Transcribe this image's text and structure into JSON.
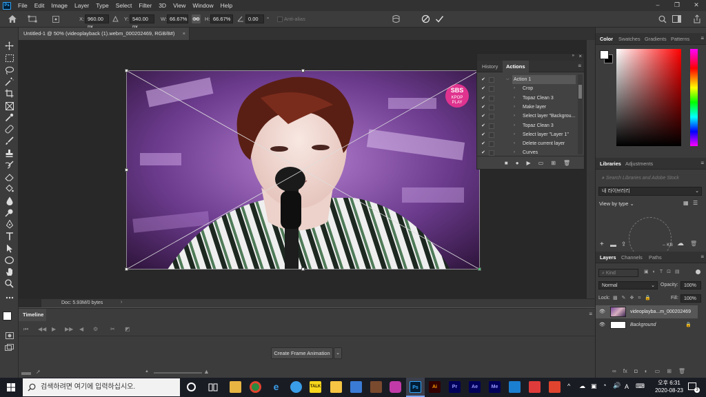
{
  "app": {
    "logo_text": "Ps"
  },
  "menubar": {
    "items": [
      "File",
      "Edit",
      "Image",
      "Layer",
      "Type",
      "Select",
      "Filter",
      "3D",
      "View",
      "Window",
      "Help"
    ]
  },
  "window_controls": [
    "–",
    "❐",
    "✕"
  ],
  "options_bar": {
    "x_label": "X:",
    "x_value": "960.00 px",
    "y_label": "Y:",
    "y_value": "540.00 px",
    "w_label": "W:",
    "w_value": "66.67%",
    "h_label": "H:",
    "h_value": "66.67%",
    "angle_value": "0.00",
    "angle_unit": "°",
    "antialias_label": "Anti-alias"
  },
  "document": {
    "tab_title": "Untitled-1 @ 50% (videoplayback (1).webm_000202469, RGB/8#)",
    "status_text": "Doc: 5.93M/0 bytes",
    "watermark_line1": "SBS",
    "watermark_line2": "KPOP",
    "watermark_line3": "PLAY"
  },
  "actions_panel": {
    "tabs": [
      "History",
      "Actions"
    ],
    "active_tab": "Actions",
    "items": [
      {
        "label": "Action 1",
        "level": 0,
        "checked": true
      },
      {
        "label": "Crop",
        "level": 1,
        "checked": true
      },
      {
        "label": "Topaz Clean 3",
        "level": 1,
        "checked": true
      },
      {
        "label": "Make layer",
        "level": 1,
        "checked": true
      },
      {
        "label": "Select layer \"Backgrou...",
        "level": 1,
        "checked": true
      },
      {
        "label": "Topaz Clean 3",
        "level": 1,
        "checked": true
      },
      {
        "label": "Select layer \"Layer 1\"",
        "level": 1,
        "checked": true
      },
      {
        "label": "Delete current layer",
        "level": 1,
        "checked": true
      },
      {
        "label": "Curves",
        "level": 1,
        "checked": true
      }
    ]
  },
  "timeline": {
    "tab_label": "Timeline",
    "create_button": "Create Frame Animation"
  },
  "color_panel": {
    "tabs": [
      "Color",
      "Swatches",
      "Gradients",
      "Patterns"
    ],
    "active_tab": "Color",
    "hue_color": "#ff0000"
  },
  "libraries_panel": {
    "tabs": [
      "Libraries",
      "Adjustments"
    ],
    "active_tab": "Libraries",
    "search_placeholder": "Search Libraries and Adobe Stock",
    "library_name": "내 라이브러리",
    "view_by": "View by type",
    "size_label": "-- KB"
  },
  "layers_panel": {
    "tabs": [
      "Layers",
      "Channels",
      "Paths"
    ],
    "active_tab": "Layers",
    "filter_label": "Kind",
    "blend_mode": "Normal",
    "opacity_label": "Opacity:",
    "opacity_value": "100%",
    "lock_label": "Lock:",
    "fill_label": "Fill:",
    "fill_value": "100%",
    "layers": [
      {
        "name": "videoplayba...m_000202469",
        "selected": true
      },
      {
        "name": "Background",
        "selected": false
      }
    ]
  },
  "taskbar": {
    "search_placeholder": "검색하려면 여기에 입력하십시오.",
    "apps": [
      "Ai",
      "Pr",
      "Ae",
      "Me"
    ],
    "ime": "A",
    "time": "오후 6:31",
    "date": "2020-08-23",
    "notification_count": "3"
  }
}
